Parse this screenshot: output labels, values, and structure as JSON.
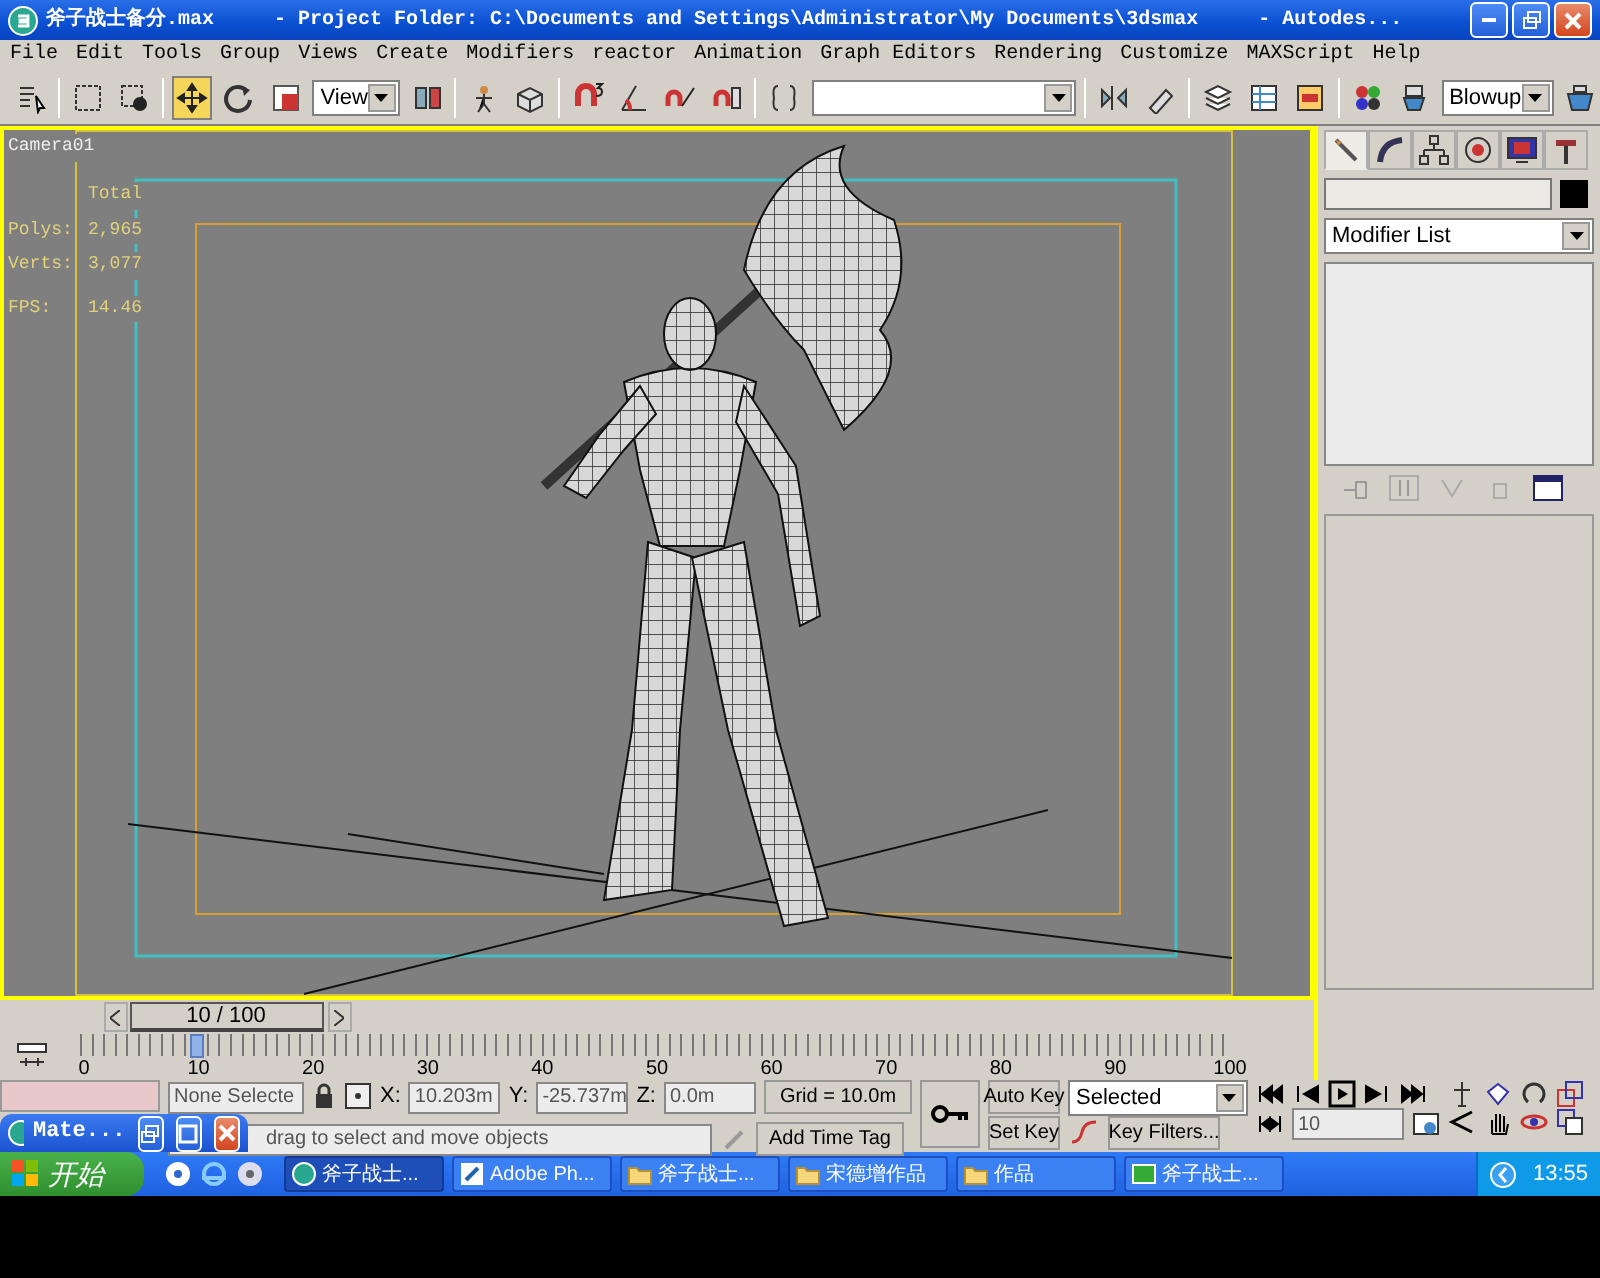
{
  "window": {
    "title": "斧子战士备分.max     - Project Folder: C:\\Documents and Settings\\Administrator\\My Documents\\3dsmax     - Autodes..."
  },
  "menu": [
    "File",
    "Edit",
    "Tools",
    "Group",
    "Views",
    "Create",
    "Modifiers",
    "reactor",
    "Animation",
    "Graph Editors",
    "Rendering",
    "Customize",
    "MAXScript",
    "Help"
  ],
  "toolbar": {
    "reference_coord": "View",
    "render_type": "Blowup"
  },
  "viewport": {
    "label": "Camera01",
    "stats_header": "Total",
    "stats": [
      {
        "label": "Polys:",
        "value": "2,965"
      },
      {
        "label": "Verts:",
        "value": "3,077"
      },
      {
        "label": "FPS:",
        "value": "14.46"
      }
    ]
  },
  "command_panel": {
    "tabs": [
      {
        "kind": "create",
        "selected": true
      },
      {
        "kind": "modify",
        "selected": false
      },
      {
        "kind": "hierarchy",
        "selected": false
      },
      {
        "kind": "motion",
        "selected": false
      },
      {
        "kind": "display",
        "selected": false
      },
      {
        "kind": "utilities",
        "selected": false
      }
    ],
    "modifier_list": "Modifier List"
  },
  "time_slider": {
    "label": "10 / 100",
    "level": 0.1
  },
  "ruler": {
    "ticks": [
      "0",
      "10",
      "20",
      "30",
      "40",
      "50",
      "60",
      "70",
      "80",
      "90",
      "100"
    ]
  },
  "status": {
    "selection": "None Selecte",
    "x_label": "X:",
    "x": "10.203m",
    "y_label": "Y:",
    "y": "-25.737m",
    "z_label": "Z:",
    "z": "0.0m",
    "grid": "Grid = 10.0m",
    "prompt": "drag to select and move objects",
    "time_tag": "Add Time Tag"
  },
  "animation": {
    "auto_key": "Auto Key",
    "set_key": "Set Key",
    "key_mode": "Selected",
    "key_filters": "Key Filters...",
    "frame": "10"
  },
  "floating_window": {
    "title": "Mate..."
  },
  "taskbar": {
    "start": "开始",
    "tasks": [
      {
        "kind": "app",
        "label": "斧子战士...",
        "selected": true
      },
      {
        "kind": "photoshop",
        "label": "Adobe Ph...",
        "selected": false
      },
      {
        "kind": "folder",
        "label": "斧子战士...",
        "selected": false
      },
      {
        "kind": "folder",
        "label": "宋德增作品",
        "selected": false
      },
      {
        "kind": "folder",
        "label": "作品",
        "selected": false
      },
      {
        "kind": "game",
        "label": "斧子战士...",
        "selected": false
      }
    ],
    "clock": "13:55"
  }
}
